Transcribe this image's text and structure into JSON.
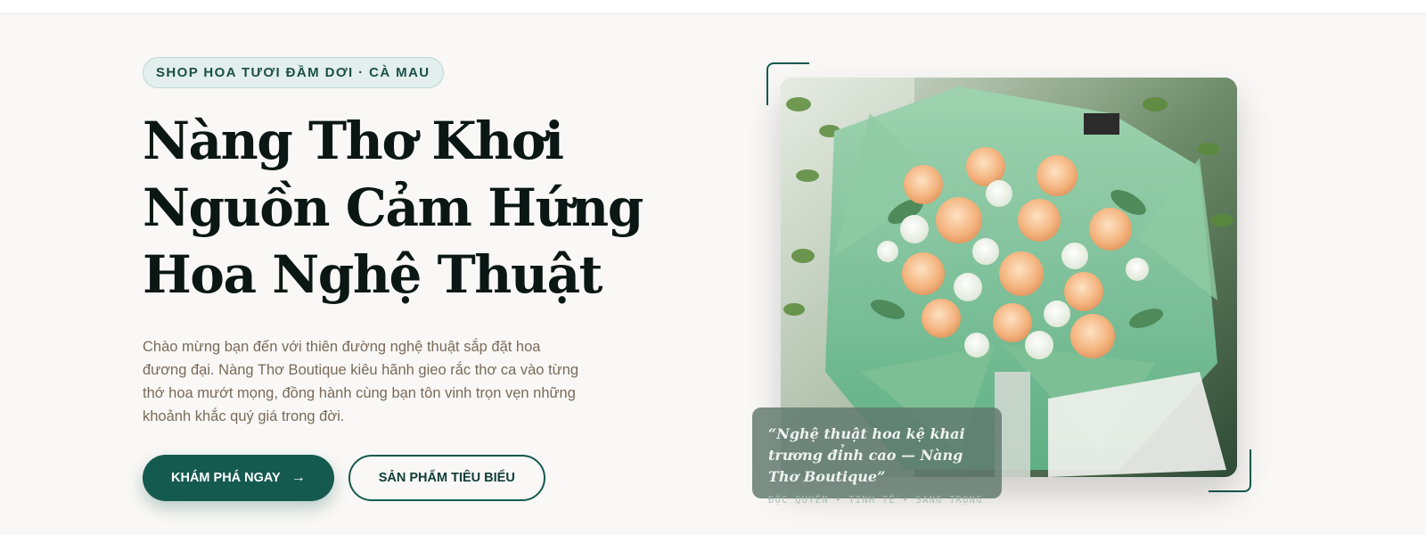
{
  "hero": {
    "badge": "SHOP HOA TƯƠI ĐẦM DƠI · CÀ MAU",
    "headline": "Nàng Thơ Khơi Nguồn Cảm Hứng Hoa Nghệ Thuật",
    "intro": "Chào mừng bạn đến với thiên đường nghệ thuật sắp đặt hoa đương đại. Nàng Thơ Boutique kiêu hãnh gieo rắc thơ ca vào từng thớ hoa mướt mọng, đồng hành cùng bạn tôn vinh trọn vẹn những khoảnh khắc quý giá trong đời.",
    "primary_cta": "KHÁM PHÁ NGAY",
    "primary_cta_icon": "arrow-right-icon",
    "secondary_cta": "SẢN PHẨM TIÊU BIỂU"
  },
  "showcase": {
    "quote": "“Nghệ thuật hoa kệ khai trương đỉnh cao — Nàng Thơ Boutique”",
    "tags": "ĐỘC QUYỀN • TINH TẾ • SANG TRỌNG"
  },
  "colors": {
    "accent": "#155a4f",
    "background": "#f9f8f6",
    "heading": "#0a1714",
    "body_text": "#7a6a58"
  }
}
